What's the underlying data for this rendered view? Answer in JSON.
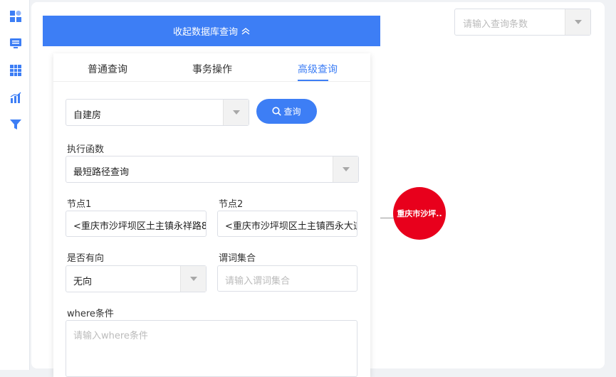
{
  "sidebar": {
    "icons": [
      "dashboard-icon",
      "monitor-icon",
      "grid-icon",
      "chart-icon",
      "filter-icon"
    ],
    "accent": "#3d7ef5"
  },
  "top_right": {
    "count_placeholder": "请输入查询条数"
  },
  "collapse_button": {
    "label": "收起数据库查询"
  },
  "tabs": [
    {
      "label": "普通查询",
      "active": false
    },
    {
      "label": "事务操作",
      "active": false
    },
    {
      "label": "高级查询",
      "active": true
    }
  ],
  "advanced": {
    "type_select_value": "自建房",
    "query_button_label": "查询",
    "function_label": "执行函数",
    "function_value": "最短路径查询",
    "node1_label": "节点1",
    "node1_value": "<重庆市沙坪坝区土主镇永祥路8",
    "node2_label": "节点2",
    "node2_value": "<重庆市沙坪坝区土主镇西永大道",
    "directed_label": "是否有向",
    "directed_value": "无向",
    "predicate_label": "谓词集合",
    "predicate_placeholder": "请输入谓词集合",
    "where_label": "where条件",
    "where_placeholder": "请输入where条件"
  },
  "graph": {
    "node_label": "重庆市沙坪..",
    "node_color": "#e8001c"
  }
}
